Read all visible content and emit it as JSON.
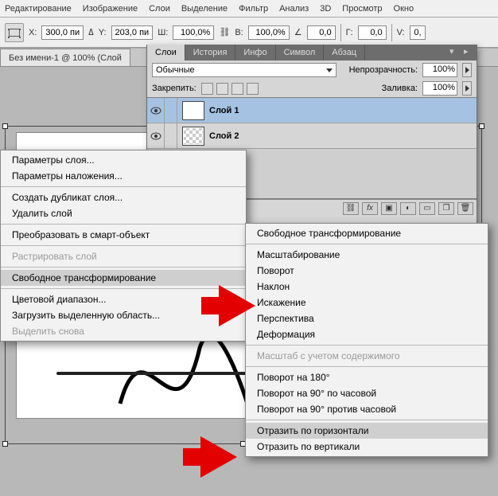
{
  "menubar": [
    "Редактирование",
    "Изображение",
    "Слои",
    "Выделение",
    "Фильтр",
    "Анализ",
    "3D",
    "Просмотр",
    "Окно"
  ],
  "options": {
    "x_label": "X:",
    "x": "300,0 пи",
    "y_label": "Y:",
    "y": "203,0 пи",
    "w_label": "Ш:",
    "w": "100,0%",
    "h_label": "В:",
    "h": "100,0%",
    "rot_label": "",
    "rot": "0,0",
    "g_label": "Г:",
    "g": "0,0",
    "v_label": "V:",
    "v": "0,"
  },
  "doc_tab": "Без имени-1 @ 100% (Слой",
  "panel": {
    "tabs": [
      "Слои",
      "История",
      "Инфо",
      "Символ",
      "Абзац"
    ],
    "blend_mode": "Обычные",
    "opacity_label": "Непрозрачность:",
    "opacity_value": "100%",
    "lock_label": "Закрепить:",
    "fill_label": "Заливка:",
    "fill_value": "100%",
    "layers": [
      {
        "name": "Слой 1",
        "active": true,
        "checker": false
      },
      {
        "name": "Слой 2",
        "active": false,
        "checker": true
      }
    ]
  },
  "ctx_left": [
    {
      "label": "Параметры слоя...",
      "type": "item"
    },
    {
      "label": "Параметры наложения...",
      "type": "item"
    },
    {
      "type": "sep"
    },
    {
      "label": "Создать дубликат слоя...",
      "type": "item"
    },
    {
      "label": "Удалить слой",
      "type": "item"
    },
    {
      "type": "sep"
    },
    {
      "label": "Преобразовать в смарт-объект",
      "type": "item"
    },
    {
      "type": "sep"
    },
    {
      "label": "Растрировать слой",
      "type": "item",
      "disabled": true
    },
    {
      "type": "sep"
    },
    {
      "label": "Свободное трансформирование",
      "type": "item",
      "highlight": true
    },
    {
      "type": "sep"
    },
    {
      "label": "Цветовой диапазон...",
      "type": "item"
    },
    {
      "label": "Загрузить выделенную область...",
      "type": "item"
    },
    {
      "label": "Выделить снова",
      "type": "item",
      "disabled": true
    }
  ],
  "ctx_right": [
    {
      "label": "Свободное трансформирование",
      "type": "item"
    },
    {
      "type": "sep"
    },
    {
      "label": "Масштабирование",
      "type": "item"
    },
    {
      "label": "Поворот",
      "type": "item"
    },
    {
      "label": "Наклон",
      "type": "item"
    },
    {
      "label": "Искажение",
      "type": "item"
    },
    {
      "label": "Перспектива",
      "type": "item"
    },
    {
      "label": "Деформация",
      "type": "item"
    },
    {
      "type": "sep"
    },
    {
      "label": "Масштаб с учетом содержимого",
      "type": "item",
      "disabled": true
    },
    {
      "type": "sep"
    },
    {
      "label": "Поворот на 180°",
      "type": "item"
    },
    {
      "label": "Поворот на 90° по часовой",
      "type": "item"
    },
    {
      "label": "Поворот на 90° против часовой",
      "type": "item"
    },
    {
      "type": "sep"
    },
    {
      "label": "Отразить по горизонтали",
      "type": "item",
      "highlight": true
    },
    {
      "label": "Отразить по вертикали",
      "type": "item"
    }
  ]
}
